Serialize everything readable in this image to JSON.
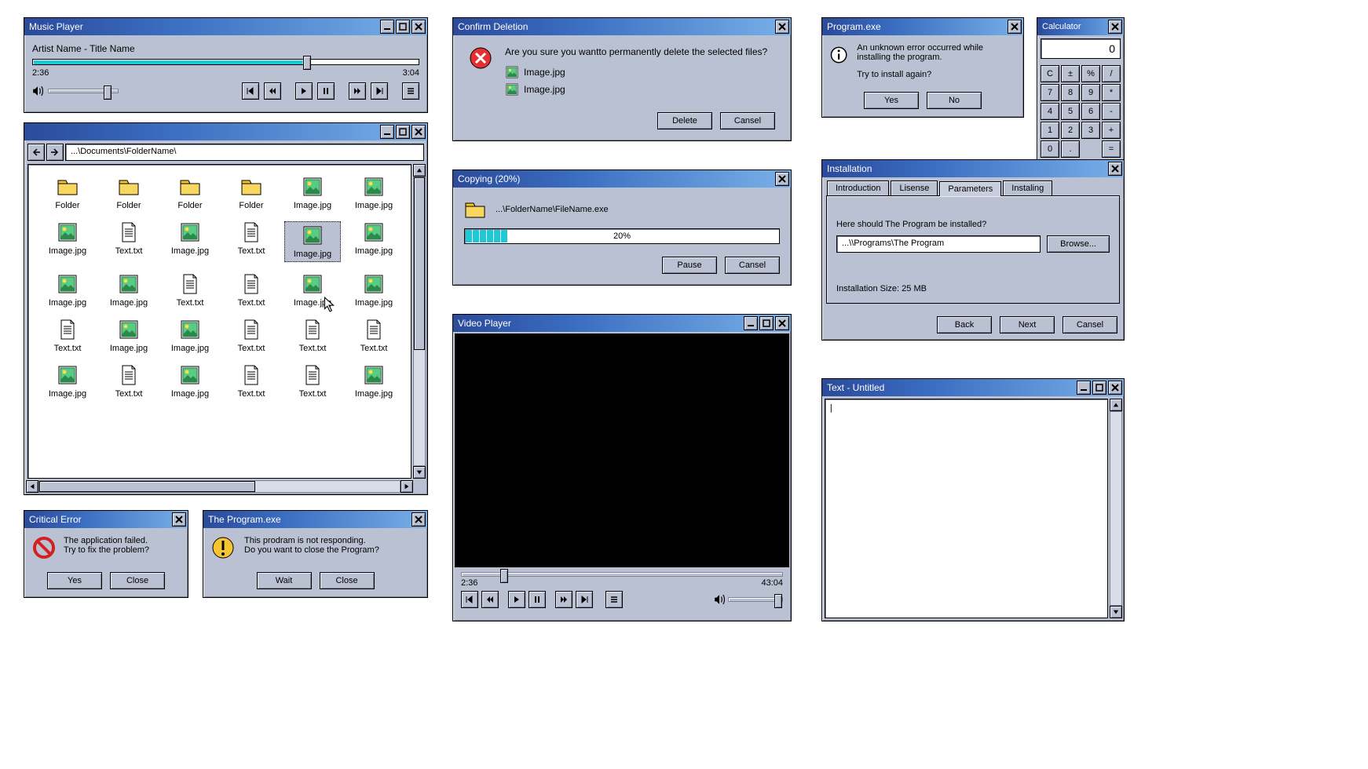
{
  "music": {
    "title": "Music Player",
    "track": "Artist Name - Title Name",
    "elapsed": "2:36",
    "total": "3:04"
  },
  "explorer": {
    "path": "...\\Documents\\FolderName\\",
    "items": [
      {
        "type": "folder",
        "label": "Folder"
      },
      {
        "type": "folder",
        "label": "Folder"
      },
      {
        "type": "folder",
        "label": "Folder"
      },
      {
        "type": "folder",
        "label": "Folder"
      },
      {
        "type": "image",
        "label": "Image.jpg"
      },
      {
        "type": "image",
        "label": "Image.jpg"
      },
      {
        "type": "image",
        "label": "Image.jpg"
      },
      {
        "type": "text",
        "label": "Text.txt"
      },
      {
        "type": "image",
        "label": "Image.jpg"
      },
      {
        "type": "text",
        "label": "Text.txt"
      },
      {
        "type": "image",
        "label": "Image.jpg",
        "selected": true
      },
      {
        "type": "image",
        "label": "Image.jpg"
      },
      {
        "type": "image",
        "label": "Image.jpg"
      },
      {
        "type": "image",
        "label": "Image.jpg"
      },
      {
        "type": "text",
        "label": "Text.txt"
      },
      {
        "type": "text",
        "label": "Text.txt"
      },
      {
        "type": "image",
        "label": "Image.jpg"
      },
      {
        "type": "image",
        "label": "Image.jpg"
      },
      {
        "type": "text",
        "label": "Text.txt"
      },
      {
        "type": "image",
        "label": "Image.jpg"
      },
      {
        "type": "image",
        "label": "Image.jpg"
      },
      {
        "type": "text",
        "label": "Text.txt"
      },
      {
        "type": "text",
        "label": "Text.txt"
      },
      {
        "type": "text",
        "label": "Text.txt"
      },
      {
        "type": "image",
        "label": "Image.jpg"
      },
      {
        "type": "text",
        "label": "Text.txt"
      },
      {
        "type": "image",
        "label": "Image.jpg"
      },
      {
        "type": "text",
        "label": "Text.txt"
      },
      {
        "type": "text",
        "label": "Text.txt"
      },
      {
        "type": "image",
        "label": "Image.jpg"
      }
    ]
  },
  "critical": {
    "title": "Critical Error",
    "line1": "The application failed.",
    "line2": "Try to fix the problem?",
    "yes": "Yes",
    "close": "Close"
  },
  "notresp": {
    "title": "The Program.exe",
    "line1": "This prodram is not responding.",
    "line2": "Do you want to close the Program?",
    "wait": "Wait",
    "close": "Close"
  },
  "confirm": {
    "title": "Confirm Deletion",
    "question": "Are you sure you wantto permanently delete the selected files?",
    "file1": "Image.jpg",
    "file2": "Image.jpg",
    "delete": "Delete",
    "cancel": "Cansel"
  },
  "copying": {
    "title": "Copying (20%)",
    "path": "...\\FolderName\\FileName.exe",
    "percent": "20%",
    "pause": "Pause",
    "cancel": "Cansel"
  },
  "video": {
    "title": "Video Player",
    "elapsed": "2:36",
    "total": "43:04"
  },
  "error": {
    "title": "Program.exe",
    "line1": "An unknown error occurred while installing the program.",
    "line2": "Try to install again?",
    "yes": "Yes",
    "no": "No"
  },
  "install": {
    "title": "Installation",
    "tabs": [
      "Introduction",
      "Lisense",
      "Parameters",
      "Instaling"
    ],
    "question": "Here should The Program be installed?",
    "path": "...\\\\Programs\\The Program",
    "browse": "Browse...",
    "size": "Installation Size: 25 MB",
    "back": "Back",
    "next": "Next",
    "cancel": "Cansel"
  },
  "notepad": {
    "title": "Text - Untitled",
    "content": "|"
  },
  "calc": {
    "title": "Calculator",
    "display": "0",
    "keys": [
      "C",
      "±",
      "%",
      "/",
      "7",
      "8",
      "9",
      "*",
      "4",
      "5",
      "6",
      "-",
      "1",
      "2",
      "3",
      "+",
      "0",
      ".",
      "",
      "="
    ]
  }
}
